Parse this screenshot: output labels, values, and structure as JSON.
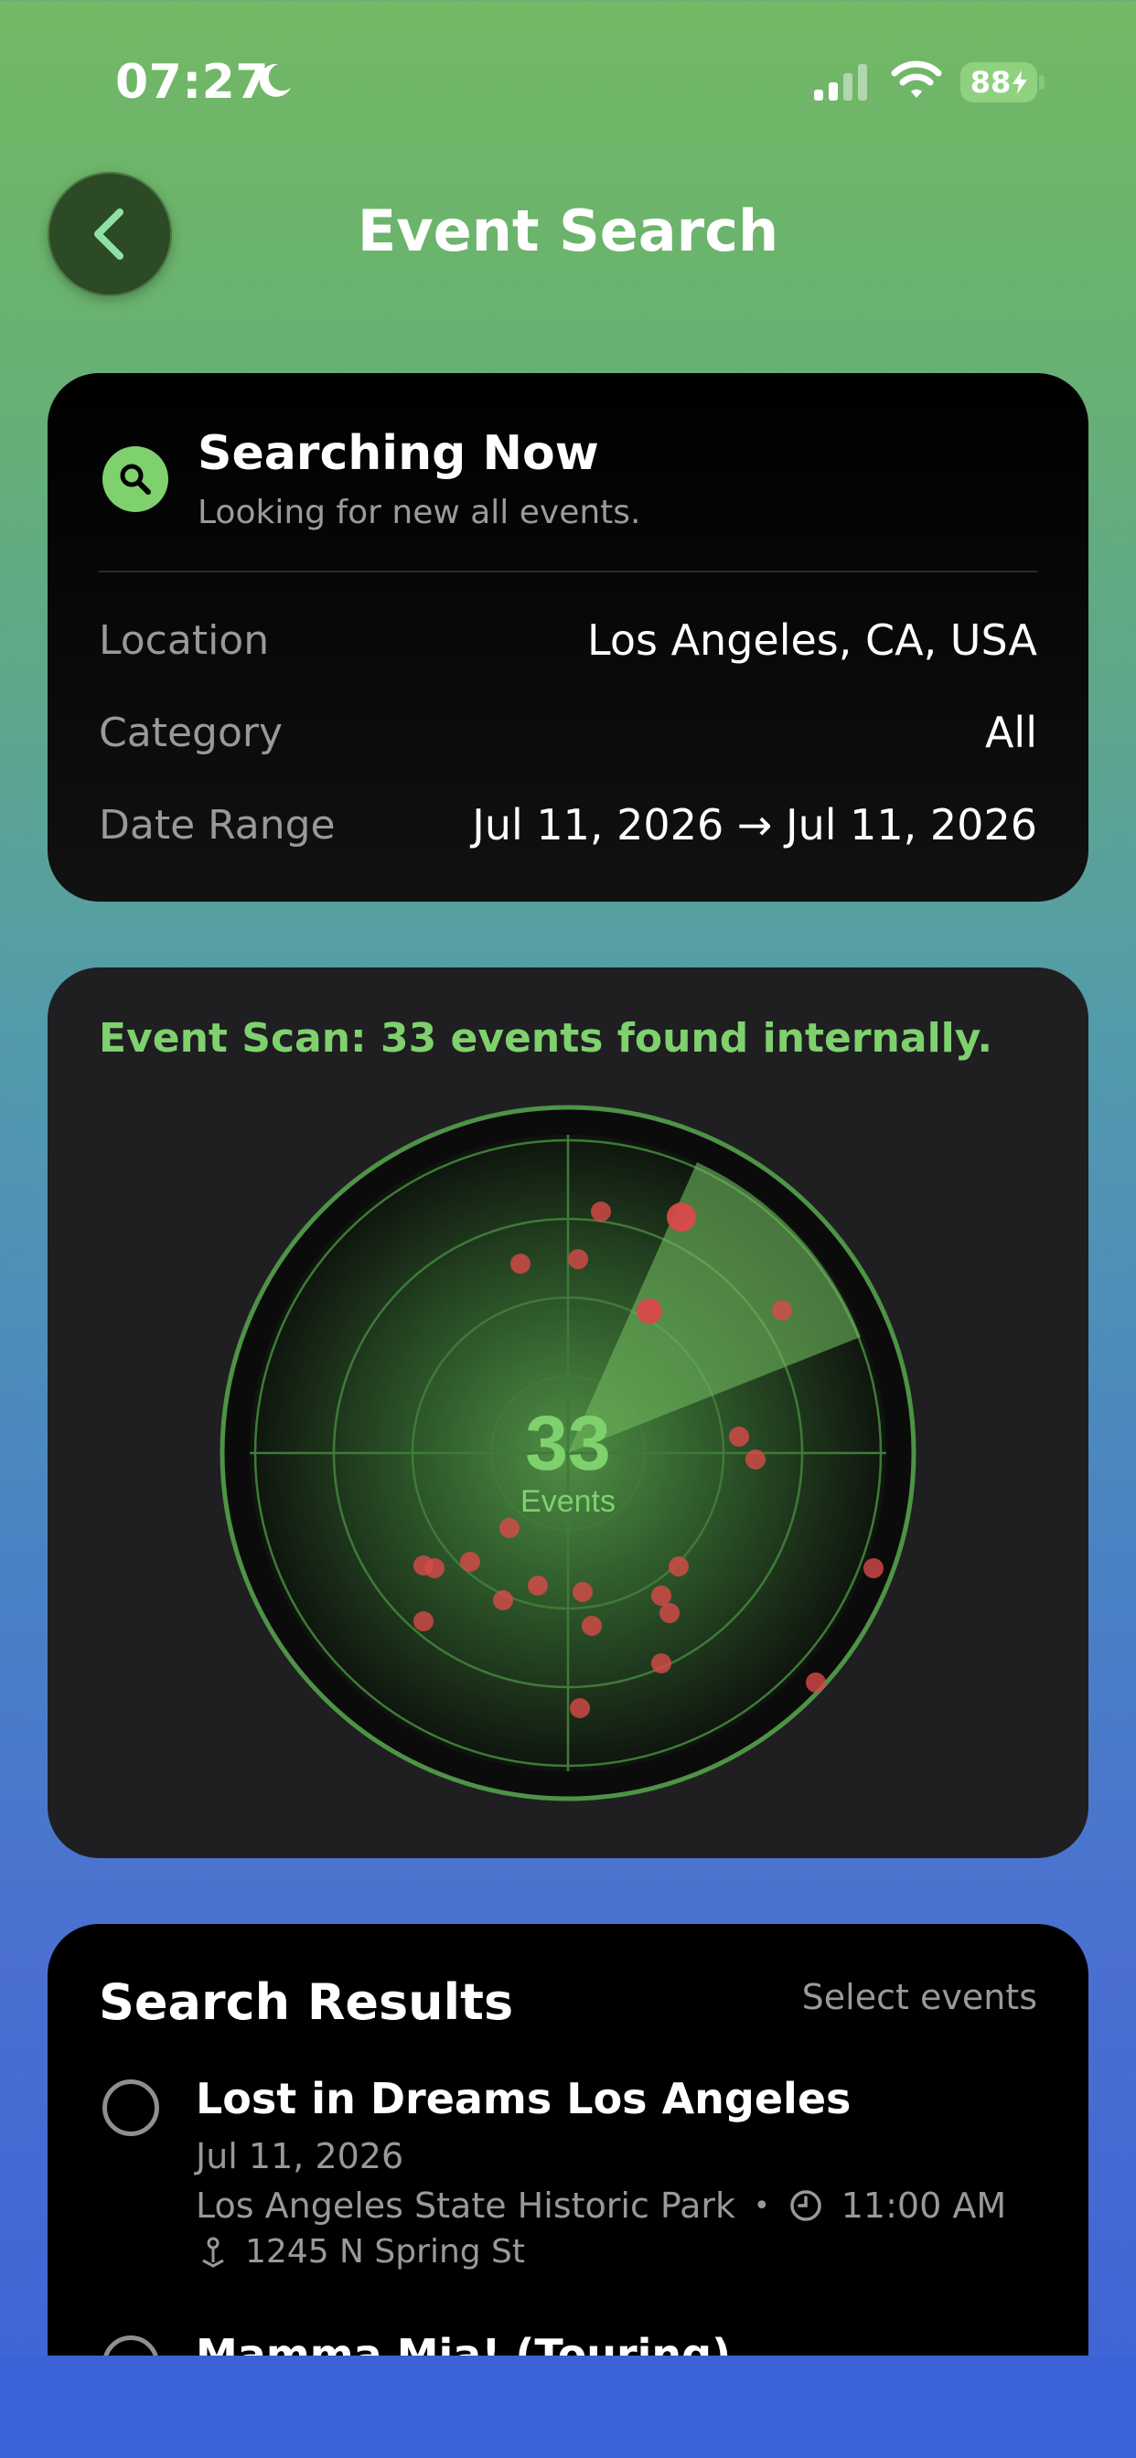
{
  "status_bar": {
    "time": "07:27",
    "battery": "88",
    "icons": [
      "moon-icon",
      "signal-icon",
      "wifi-icon",
      "battery-charging-icon"
    ]
  },
  "header": {
    "title": "Event Search",
    "back_icon": "chevron-left-icon"
  },
  "search_card": {
    "title": "Searching Now",
    "subtitle": "Looking for new all events.",
    "icon": "search-icon",
    "rows": [
      {
        "label": "Location",
        "value": "Los Angeles, CA, USA"
      },
      {
        "label": "Category",
        "value": "All"
      },
      {
        "label": "Date Range",
        "value": "Jul 11, 2026 → Jul 11, 2026"
      }
    ]
  },
  "scan_card": {
    "title": "Event Scan: 33 events found internally.",
    "count": "33",
    "count_label": "Events"
  },
  "results": {
    "title": "Search Results",
    "select_label": "Select events",
    "items": [
      {
        "title": "Lost in Dreams Los Angeles",
        "date": "Jul 11, 2026",
        "venue": "Los Angeles State Historic Park",
        "time": "11:00 AM",
        "address": "1245 N Spring St"
      },
      {
        "title": "Mamma Mia! (Touring)"
      }
    ]
  },
  "colors": {
    "accent_green": "#7fd16e",
    "blip_red": "#d94a4a",
    "card_dark": "#1f1f21"
  }
}
